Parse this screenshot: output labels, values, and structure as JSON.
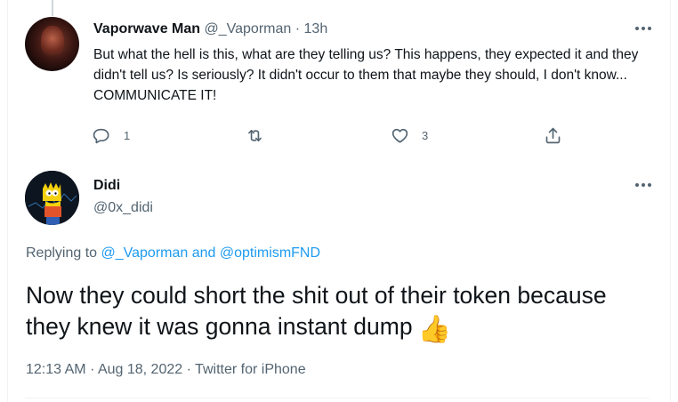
{
  "reply_tweet": {
    "display_name": "Vaporwave Man",
    "handle": "@_Vaporman",
    "separator": "·",
    "time": "13h",
    "text": "But what the hell is this, what are they telling us? This happens, they expected it and they didn't tell us? Is seriously? It didn't occur to them that maybe they should, I don't know... COMMUNICATE IT!",
    "reply_count": "1",
    "like_count": "3",
    "icons": [
      "reply-icon",
      "retweet-icon",
      "like-icon",
      "share-icon",
      "more-icon"
    ]
  },
  "main_tweet": {
    "display_name": "Didi",
    "handle": "@0x_didi",
    "replying_prefix": "Replying to",
    "replying_user1": "@_Vaporman",
    "replying_and": "and",
    "replying_user2": "@optimismFND",
    "text": "Now they could short the shit out of their token because they knew it was gonna instant dump",
    "emoji": "👍",
    "time": "12:13 AM",
    "dot1": "·",
    "date": "Aug 18, 2022",
    "dot2": "·",
    "source": "Twitter for iPhone"
  },
  "colors": {
    "text_primary": "#0f1419",
    "text_secondary": "#536471",
    "link": "#1d9bf0",
    "divider": "#eff3f4"
  }
}
